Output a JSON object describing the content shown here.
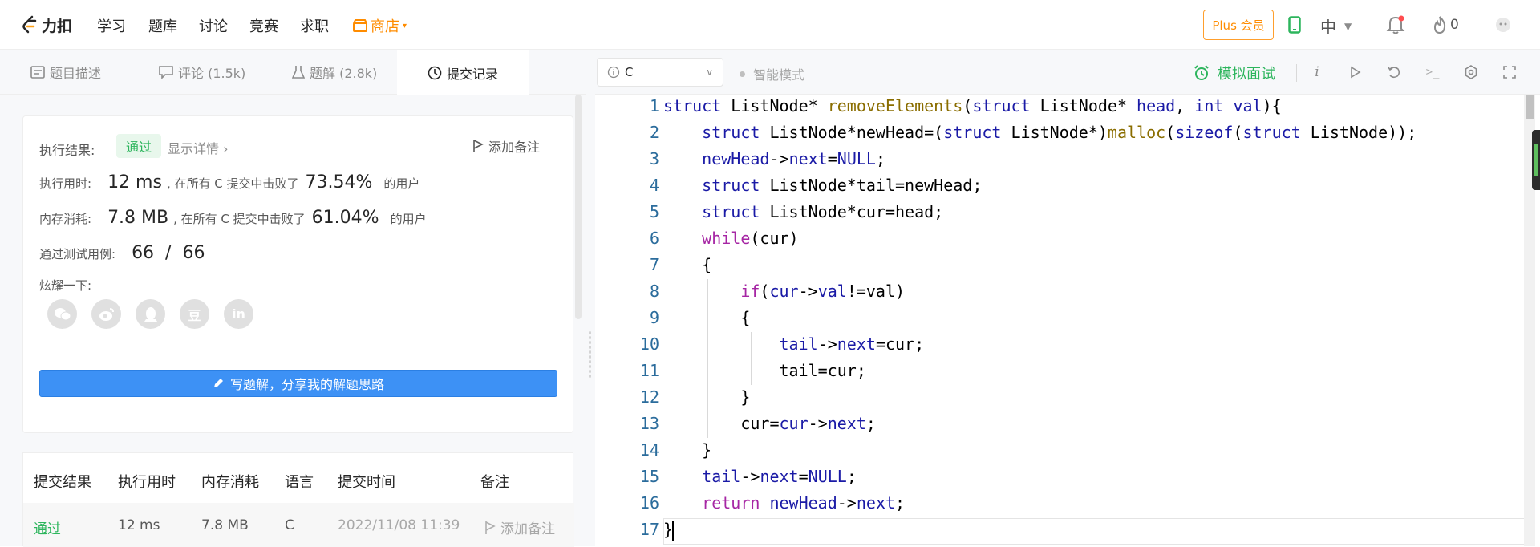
{
  "nav": {
    "logo_text": "力扣",
    "links": [
      "学习",
      "题库",
      "讨论",
      "竞赛",
      "求职"
    ],
    "shop_label": "商店",
    "plus_label": "Plus 会员",
    "lang_label": "中",
    "fire_count": "0"
  },
  "left_tabs": [
    {
      "label": "题目描述",
      "icon": "description-icon"
    },
    {
      "label": "评论 (1.5k)",
      "icon": "comment-icon"
    },
    {
      "label": "题解 (2.8k)",
      "icon": "flask-icon"
    },
    {
      "label": "提交记录",
      "icon": "clock-icon"
    }
  ],
  "result": {
    "exec_result_label": "执行结果:",
    "status": "通过",
    "detail_link": "显示详情",
    "add_note": "添加备注",
    "time_label": "执行用时:",
    "time_value": "12 ms",
    "time_text": ", 在所有 C 提交中击败了",
    "time_percent": "73.54%",
    "users_text": "的用户",
    "mem_label": "内存消耗:",
    "mem_value": "7.8 MB",
    "mem_text": ", 在所有 C 提交中击败了",
    "mem_percent": "61.04%",
    "tests_label": "通过测试用例:",
    "tests_value": "66  /  66",
    "share_label": "炫耀一下:",
    "share_icons": [
      "wechat-icon",
      "weibo-icon",
      "qq-icon",
      "douban-icon",
      "linkedin-icon"
    ],
    "share_glyphs": [
      "",
      "",
      "",
      "豆",
      "in"
    ],
    "write_button": "写题解，分享我的解题思路"
  },
  "submissions": {
    "headers": [
      "提交结果",
      "执行用时",
      "内存消耗",
      "语言",
      "提交时间",
      "备注"
    ],
    "rows": [
      {
        "result": "通过",
        "time": "12 ms",
        "memory": "7.8 MB",
        "language": "C",
        "submitted": "2022/11/08 11:39",
        "note": "添加备注"
      }
    ]
  },
  "editor": {
    "language": "C",
    "smart_mode": "智能模式",
    "mock_interview": "模拟面试",
    "line_numbers": [
      "1",
      "2",
      "3",
      "4",
      "5",
      "6",
      "7",
      "8",
      "9",
      "10",
      "11",
      "12",
      "13",
      "14",
      "15",
      "16",
      "17"
    ]
  },
  "colors": {
    "accent_green": "#2db55d",
    "accent_orange": "#ff8c00",
    "button_blue": "#3d91f5"
  }
}
